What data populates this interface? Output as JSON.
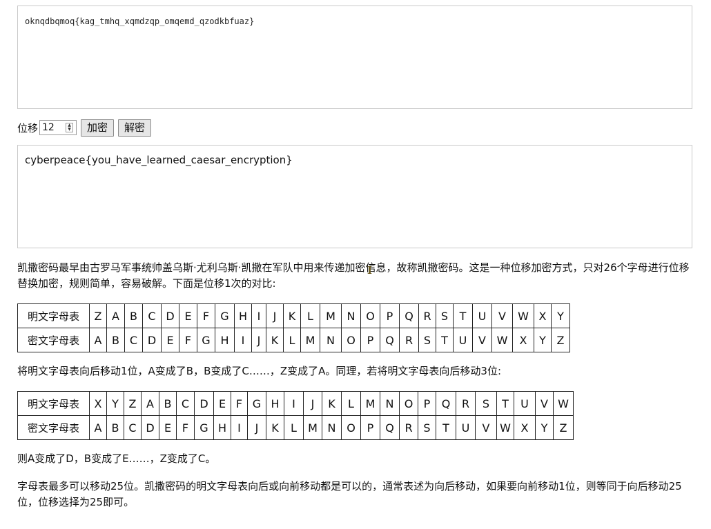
{
  "input_text": "oknqdbqmoq{kag_tmhq_xqmdzqp_omqemd_qzodkbfuaz}",
  "controls": {
    "shift_label": "位移",
    "shift_value": "12",
    "encrypt_label": "加密",
    "decrypt_label": "解密"
  },
  "output_text": "cyberpeace{you_have_learned_caesar_encryption}",
  "intro": "凯撒密码最早由古罗马军事统帅盖乌斯·尤利乌斯·凯撒在军队中用来传递加密信息，故称凯撒密码。这是一种位移加密方式，只对26个字母进行位移替换加密，规则简单，容易破解。下面是位移1次的对比:",
  "table1": {
    "plain_label": "明文字母表",
    "cipher_label": "密文字母表",
    "plain": [
      "Z",
      "A",
      "B",
      "C",
      "D",
      "E",
      "F",
      "G",
      "H",
      "I",
      "J",
      "K",
      "L",
      "M",
      "N",
      "O",
      "P",
      "Q",
      "R",
      "S",
      "T",
      "U",
      "V",
      "W",
      "X",
      "Y"
    ],
    "cipher": [
      "A",
      "B",
      "C",
      "D",
      "E",
      "F",
      "G",
      "H",
      "I",
      "J",
      "K",
      "L",
      "M",
      "N",
      "O",
      "P",
      "Q",
      "R",
      "S",
      "T",
      "U",
      "V",
      "W",
      "X",
      "Y",
      "Z"
    ]
  },
  "mid_text": "将明文字母表向后移动1位，A变成了B，B变成了C……，Z变成了A。同理，若将明文字母表向后移动3位:",
  "table2": {
    "plain_label": "明文字母表",
    "cipher_label": "密文字母表",
    "plain": [
      "X",
      "Y",
      "Z",
      "A",
      "B",
      "C",
      "D",
      "E",
      "F",
      "G",
      "H",
      "I",
      "J",
      "K",
      "L",
      "M",
      "N",
      "O",
      "P",
      "Q",
      "R",
      "S",
      "T",
      "U",
      "V",
      "W"
    ],
    "cipher": [
      "A",
      "B",
      "C",
      "D",
      "E",
      "F",
      "G",
      "H",
      "I",
      "J",
      "K",
      "L",
      "M",
      "N",
      "O",
      "P",
      "Q",
      "R",
      "S",
      "T",
      "U",
      "V",
      "W",
      "X",
      "Y",
      "Z"
    ]
  },
  "result_text": "则A变成了D，B变成了E……，Z变成了C。",
  "footer_text": "字母表最多可以移动25位。凯撒密码的明文字母表向后或向前移动都是可以的，通常表述为向后移动，如果要向前移动1位，则等同于向后移动25位，位移选择为25即可。"
}
